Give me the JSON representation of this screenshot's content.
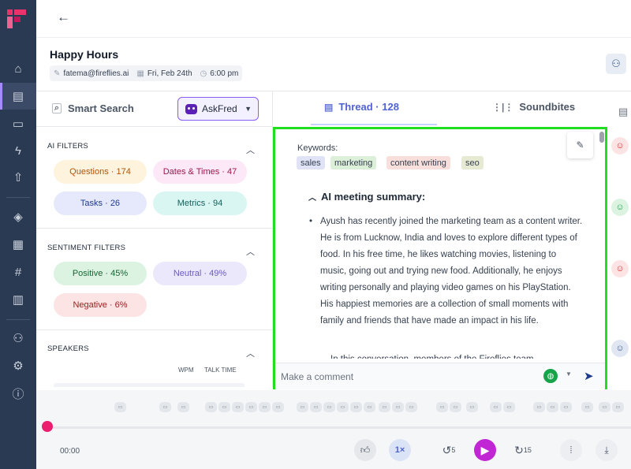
{
  "meeting": {
    "title": "Happy Hours",
    "email": "fatema@fireflies.ai",
    "date": "Fri, Feb 24th",
    "time": "6:00 pm"
  },
  "left_panel": {
    "smart_search": "Smart Search",
    "askfred": "AskFred",
    "ai_filters": {
      "heading": "AI FILTERS",
      "chips": [
        "Questions · 174",
        "Dates & Times · 47",
        "Tasks · 26",
        "Metrics · 94"
      ]
    },
    "sentiment_filters": {
      "heading": "SENTIMENT FILTERS",
      "chips": [
        "Positive · 45%",
        "Neutral · 49%",
        "Negative · 6%"
      ]
    },
    "speakers": {
      "heading": "SPEAKERS",
      "col_wpm": "WPM",
      "col_talk": "TALK TIME"
    }
  },
  "tabs": {
    "thread": "Thread · 128",
    "soundbites": "Soundbites"
  },
  "notes": {
    "keywords_label": "Keywords:",
    "keywords": [
      "sales",
      "marketing",
      "content writing",
      "seo"
    ],
    "summary_heading": "AI meeting summary:",
    "summary_text": "Ayush has recently joined the marketing team as a content writer. He is from Lucknow, India and loves to explore different types of food. In his free time, he likes watching movies, listening to music, going out and trying new food. Additionally, he enjoys writing personally and playing video games on his PlayStation. His happiest memories are a collection of small moments with family and friends that have made an impact in his life.",
    "summary_next": "In this conversation, members of the Fireflies team"
  },
  "comment": {
    "placeholder": "Make a comment"
  },
  "player": {
    "elapsed": "00:00",
    "speed": "1×",
    "skip_back": "5",
    "skip_forward": "15"
  },
  "colors": {
    "sidebar": "#2b3a53",
    "accent": "#8b5cf6",
    "highlight_border": "#22dd22",
    "playhead": "#ec1f6e"
  }
}
